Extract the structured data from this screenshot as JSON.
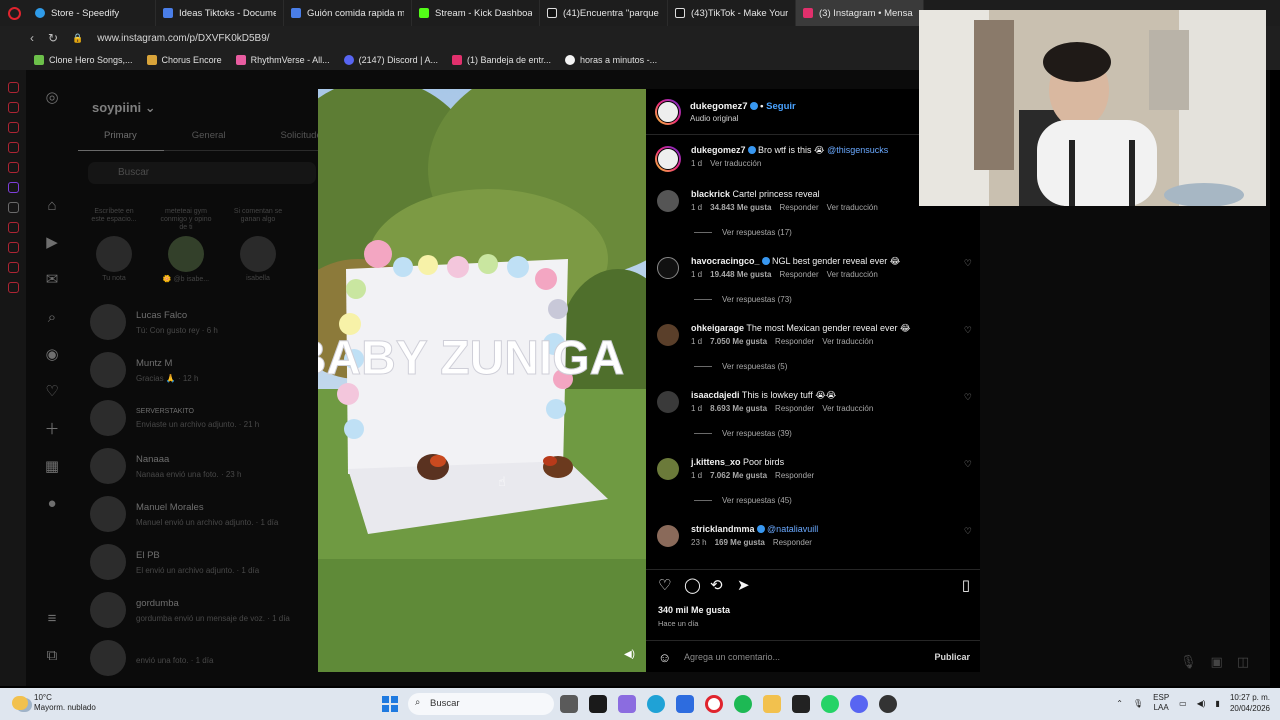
{
  "browser": {
    "tabs": [
      {
        "label": "Store - Speedify",
        "color": "#2f9be8"
      },
      {
        "label": "Ideas Tiktoks - Document",
        "color": "#4a7ee8"
      },
      {
        "label": "Guión comida rapida más",
        "color": "#4a7ee8"
      },
      {
        "label": "Stream - Kick Dashboard",
        "color": "#53fc18"
      },
      {
        "label": "(41)Encuentra \"parque el c",
        "color": "#ffffff"
      },
      {
        "label": "(43)TikTok - Make Your D",
        "color": "#ffffff"
      },
      {
        "label": "(3) Instagram • Mensa",
        "color": "#e1306c"
      }
    ],
    "url": "www.instagram.com/p/DXVFK0kD5B9/",
    "bookmarks": [
      {
        "label": "Clone Hero Songs,...",
        "color": "#6cc04a"
      },
      {
        "label": "Chorus Encore",
        "color": "#d9a43a"
      },
      {
        "label": "RhythmVerse - All...",
        "color": "#e85ca0"
      },
      {
        "label": "(2147) Discord | A...",
        "color": "#5865f2"
      },
      {
        "label": "(1) Bandeja de entr...",
        "color": "#e1306c"
      },
      {
        "label": "horas a minutos -...",
        "color": "#f4f4f4"
      }
    ]
  },
  "dm": {
    "username": "soypiini",
    "tabs": [
      "Primary",
      "General",
      "Solicitudes"
    ],
    "search_placeholder": "Buscar",
    "notes": [
      {
        "bubble": "Escríbete en este espacio...",
        "name": "Tu nota"
      },
      {
        "bubble": "meteteai gym conmigo y opino de ti",
        "name": "🌼 @b isabe..."
      },
      {
        "bubble": "Si comentan se ganan algo",
        "name": "isabella"
      }
    ],
    "conversations": [
      {
        "name": "Lucas Falco",
        "preview": "Tú: Con gusto rey · 6 h"
      },
      {
        "name": "Muntz M",
        "preview": "Gracias 🙏 · 12 h"
      },
      {
        "name": "SERVERSTAKITO",
        "preview": "Enviaste un archivo adjunto. · 21 h"
      },
      {
        "name": "Nanaaa",
        "preview": "Nanaaa envió una foto. · 23 h"
      },
      {
        "name": "Manuel Morales",
        "preview": "Manuel envió un archivo adjunto. · 1 día"
      },
      {
        "name": "El PB",
        "preview": "El envió un archivo adjunto. · 1 día"
      },
      {
        "name": "gordumba",
        "preview": "gordumba envió un mensaje de voz. · 1 día"
      },
      {
        "name": "",
        "preview": "envió una foto. · 1 día"
      }
    ]
  },
  "post": {
    "author": "dukegomez7",
    "follow_label": "Seguir",
    "audio": "Audio original",
    "caption": {
      "user": "dukegomez7",
      "text": "Bro wtf is this 😭",
      "mention": "@thisgensucks",
      "time": "1 d",
      "translate": "Ver traducción"
    },
    "comments": [
      {
        "user": "blackrick",
        "text": "Cartel princess reveal",
        "time": "1 d",
        "likes": "34.843 Me gusta",
        "reply": "Responder",
        "translate": "Ver traducción",
        "replies": "Ver respuestas (17)"
      },
      {
        "user": "havocracingco_",
        "text": "NGL best gender reveal ever 😂",
        "time": "1 d",
        "likes": "19.448 Me gusta",
        "reply": "Responder",
        "translate": "Ver traducción",
        "replies": "Ver respuestas (73)"
      },
      {
        "user": "ohkeigarage",
        "text": "The most Mexican gender reveal ever 😂",
        "time": "1 d",
        "likes": "7.050 Me gusta",
        "reply": "Responder",
        "translate": "Ver traducción",
        "replies": "Ver respuestas (5)"
      },
      {
        "user": "isaacdajedi",
        "text": "This is lowkey tuff 😭😭",
        "time": "1 d",
        "likes": "8.693 Me gusta",
        "reply": "Responder",
        "translate": "Ver traducción",
        "replies": "Ver respuestas (39)"
      },
      {
        "user": "j.kittens_xo",
        "text": "Poor birds",
        "time": "1 d",
        "likes": "7.062 Me gusta",
        "reply": "Responder",
        "translate": "",
        "replies": "Ver respuestas (45)"
      },
      {
        "user": "stricklandmma",
        "text": "",
        "mention": "@nataliavuill",
        "time": "23 h",
        "likes": "169 Me gusta",
        "reply": "Responder",
        "translate": "",
        "replies": ""
      }
    ],
    "likes_total": "340 mil Me gusta",
    "posted": "Hace un día",
    "comment_placeholder": "Agrega un comentario...",
    "publish_label": "Publicar",
    "media_sign": "BABY ZUNIGA"
  },
  "taskbar": {
    "weather_temp": "10°C",
    "weather_desc": "Mayorm. nublado",
    "search_placeholder": "Buscar",
    "lang_top": "ESP",
    "lang_bottom": "LAA",
    "time": "10:27 p. m.",
    "date": "20/04/2026"
  }
}
